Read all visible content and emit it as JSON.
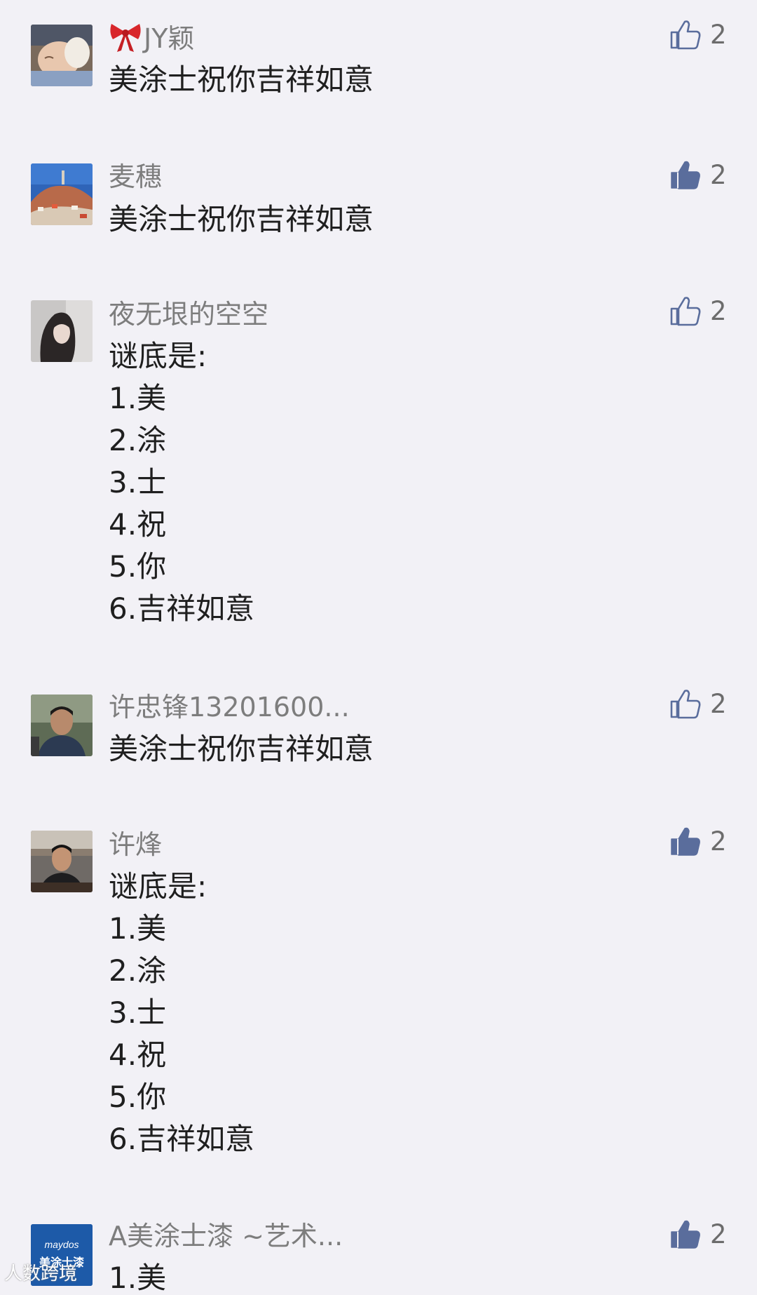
{
  "comments": [
    {
      "name": "JY颖",
      "lines": [
        "美涂士祝你吉祥如意"
      ],
      "likes": "2",
      "liked": false,
      "avatar": "baby-photo-avatar"
    },
    {
      "name": "麦穗",
      "lines": [
        "美涂士祝你吉祥如意"
      ],
      "likes": "2",
      "liked": true,
      "avatar": "hill-town-avatar"
    },
    {
      "name": "夜无垠的空空",
      "lines": [
        "谜底是:",
        "1.美",
        "2.涂",
        "3.士",
        "4.祝",
        "5.你",
        "6.吉祥如意"
      ],
      "likes": "2",
      "liked": false,
      "avatar": "girl-portrait-avatar"
    },
    {
      "name": "许忠锋13201600...",
      "lines": [
        "美涂士祝你吉祥如意"
      ],
      "likes": "2",
      "liked": false,
      "avatar": "man-portrait-avatar"
    },
    {
      "name": "许烽",
      "lines": [
        "谜底是:",
        "1.美",
        "2.涂",
        "3.士",
        "4.祝",
        "5.你",
        "6.吉祥如意"
      ],
      "likes": "2",
      "liked": true,
      "avatar": "man-restaurant-avatar"
    },
    {
      "name": "A美涂士漆 ~艺术...",
      "lines": [
        "1.美"
      ],
      "likes": "2",
      "liked": true,
      "avatar": "maydos-logo-avatar",
      "logo_text": [
        "maydos",
        "美涂士漆"
      ]
    }
  ],
  "watermark": "人数跨境",
  "colors": {
    "background": "#f2f1f6",
    "like_blue": "#5a6d9c",
    "name_gray": "#7d7d7d",
    "text": "#1f1f1f"
  }
}
